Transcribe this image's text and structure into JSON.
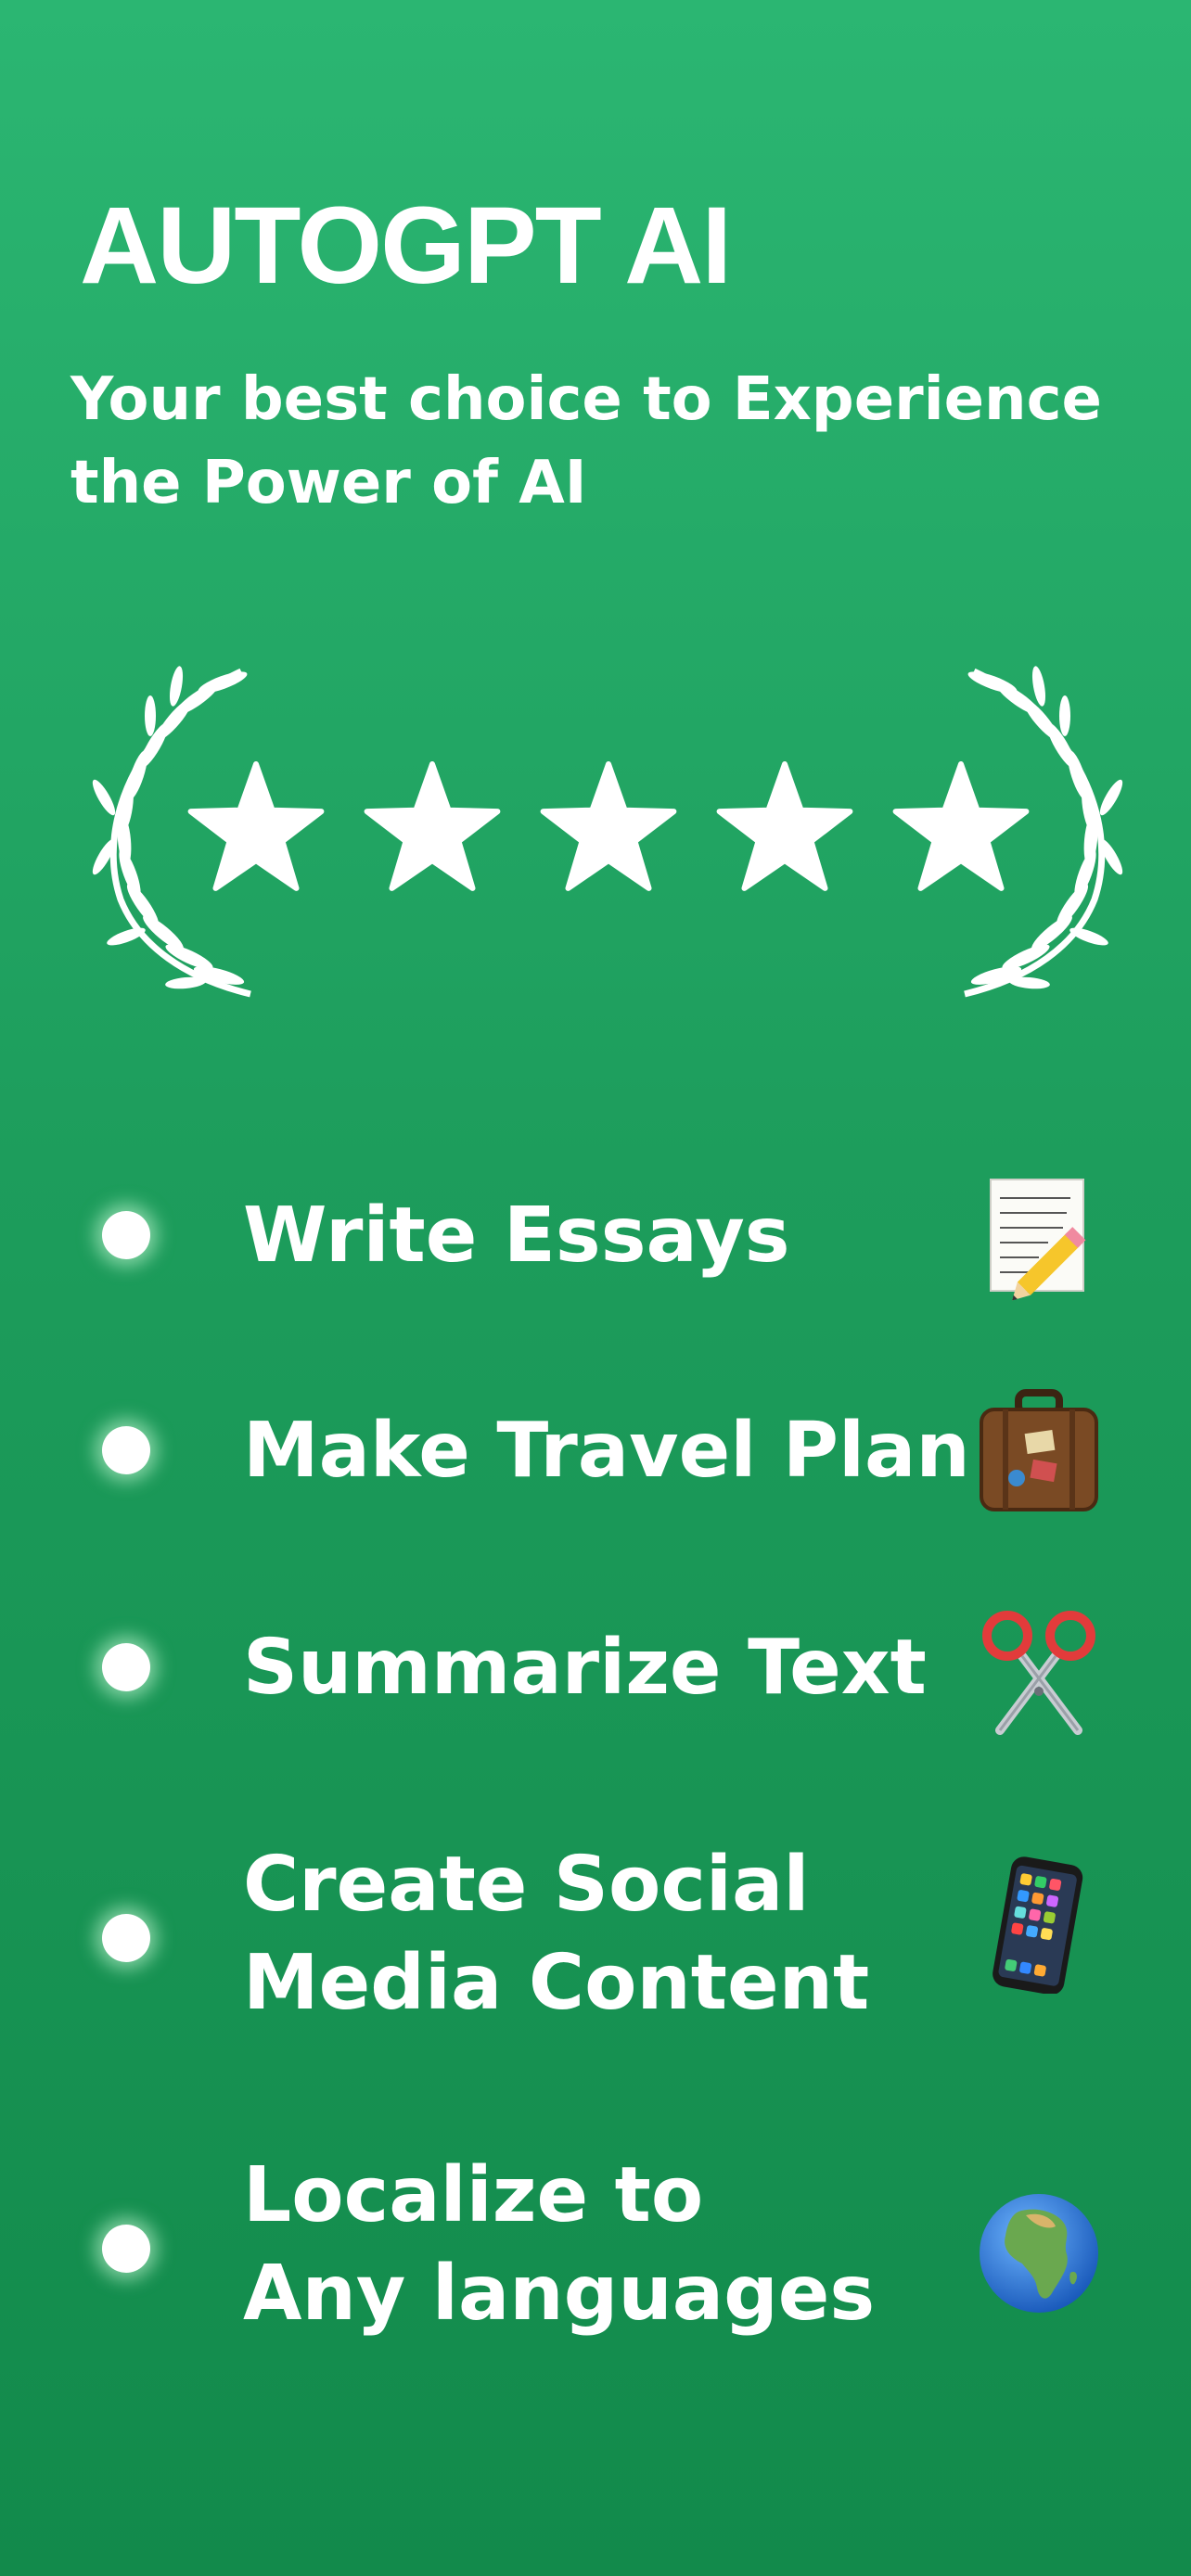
{
  "header": {
    "title": "AUTOGPT AI",
    "subtitle": "Your best choice to Experience the Power of AI"
  },
  "rating": {
    "stars": 5,
    "max": 5
  },
  "features": [
    {
      "label": "Write Essays",
      "icon": "memo-pencil-icon"
    },
    {
      "label": "Make Travel Plan",
      "icon": "suitcase-icon"
    },
    {
      "label": "Summarize Text",
      "icon": "scissors-icon"
    },
    {
      "label_line1": "Create Social",
      "label_line2": "Media Content",
      "icon": "mobile-phone-icon"
    },
    {
      "label_line1": "Localize to",
      "label_line2": "Any languages",
      "icon": "globe-africa-icon"
    }
  ],
  "colors": {
    "background_top": "#2bb672",
    "background_bottom": "#128a4b",
    "text": "#ffffff"
  }
}
